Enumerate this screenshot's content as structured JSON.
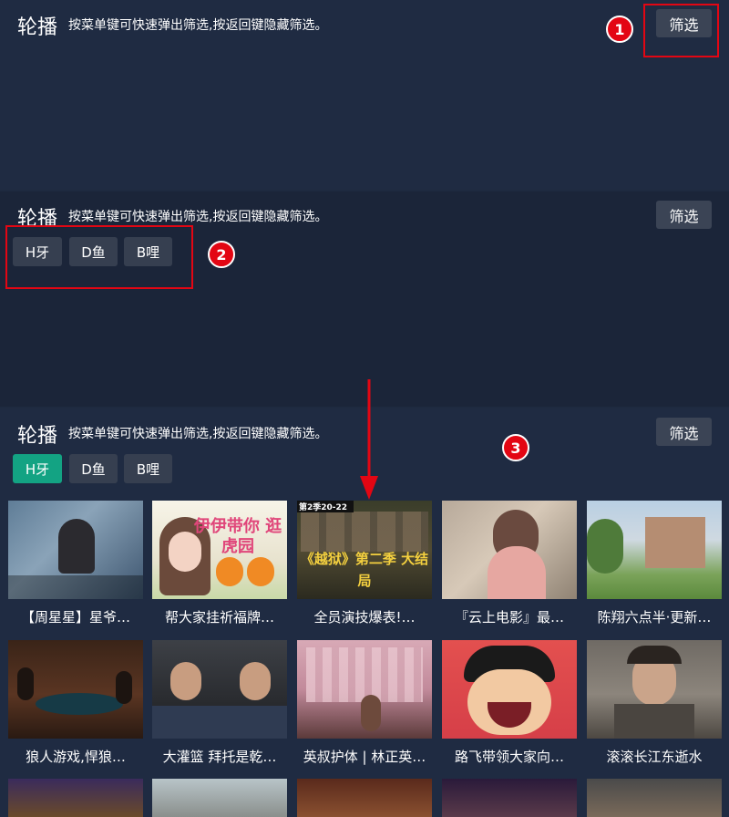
{
  "header": {
    "title": "轮播",
    "hint": "按菜单键可快速弹出筛选,按返回键隐藏筛选。",
    "filter_label": "筛选"
  },
  "tags": [
    "H牙",
    "D鱼",
    "B哩"
  ],
  "badges": [
    "1",
    "2",
    "3"
  ],
  "videos": [
    {
      "caption": "【周星星】星爷…",
      "thumb_text": ""
    },
    {
      "caption": "帮大家挂祈福牌…",
      "thumb_text": "伊伊带你 逛虎园"
    },
    {
      "caption": "全员演技爆表!…",
      "thumb_text": "《越狱》第二季 大结局",
      "thumb_sub": "第2季20-22"
    },
    {
      "caption": "『云上电影』最…",
      "thumb_text": ""
    },
    {
      "caption": "陈翔六点半·更新…",
      "thumb_text": ""
    },
    {
      "caption": "狼人游戏,悍狼…",
      "thumb_text": ""
    },
    {
      "caption": "大灌篮 拜托是乾…",
      "thumb_text": ""
    },
    {
      "caption": "英叔护体 | 林正英…",
      "thumb_text": ""
    },
    {
      "caption": "路飞带领大家向…",
      "thumb_text": ""
    },
    {
      "caption": "滚滚长江东逝水",
      "thumb_text": ""
    }
  ],
  "colors": {
    "active_tag": "#13a383",
    "annotation_red": "#e30613"
  }
}
